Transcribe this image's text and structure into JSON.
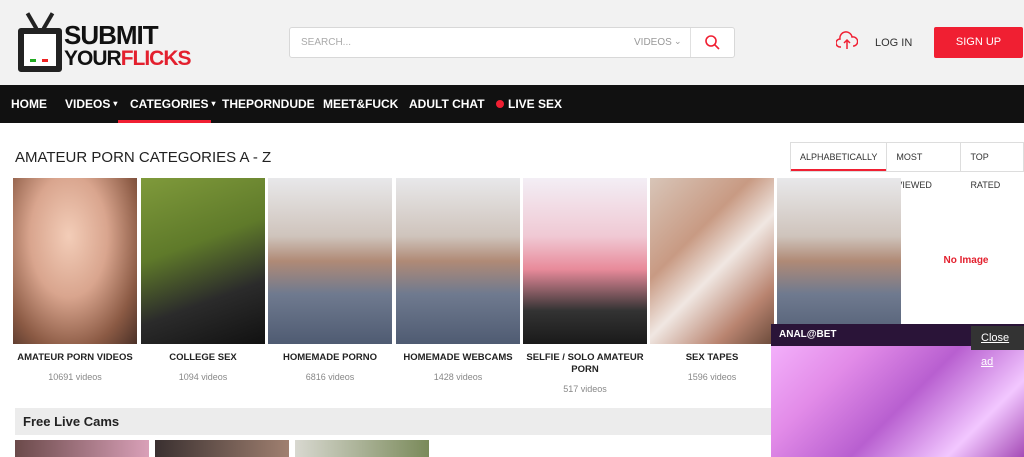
{
  "header": {
    "logo_line1": "SUBMIT",
    "logo_line2_a": "YOUR",
    "logo_line2_b": "FLICKS",
    "search_placeholder": "SEARCH...",
    "search_type": "VIDEOS",
    "login": "LOG IN",
    "signup": "SIGN UP"
  },
  "nav": {
    "items": [
      "HOME",
      "VIDEOS",
      "CATEGORIES",
      "THEPORNDUDE",
      "MEET&FUCK",
      "ADULT CHAT",
      "LIVE SEX"
    ],
    "active": "CATEGORIES"
  },
  "page": {
    "title": "AMATEUR PORN CATEGORIES A - Z",
    "sort": [
      "ALPHABETICALLY",
      "MOST VIEWED",
      "TOP RATED"
    ],
    "sort_active": "ALPHABETICALLY"
  },
  "categories": [
    {
      "title": "AMATEUR PORN VIDEOS",
      "count": "10691 videos"
    },
    {
      "title": "COLLEGE SEX",
      "count": "1094 videos"
    },
    {
      "title": "HOMEMADE PORNO",
      "count": "6816 videos"
    },
    {
      "title": "HOMEMADE WEBCAMS",
      "count": "1428 videos"
    },
    {
      "title": "SELFIE / SOLO AMATEUR PORN",
      "count": "517 videos"
    },
    {
      "title": "SEX TAPES",
      "count": "1596 videos"
    }
  ],
  "no_image": "No Image",
  "live": {
    "title": "Free Live Cams"
  },
  "ad": {
    "brand": "ANAL@BET",
    "close": "Close ad"
  },
  "colors": {
    "accent": "#f01f32",
    "nav_bg": "#111111",
    "header_bg": "#f2f2f2"
  }
}
